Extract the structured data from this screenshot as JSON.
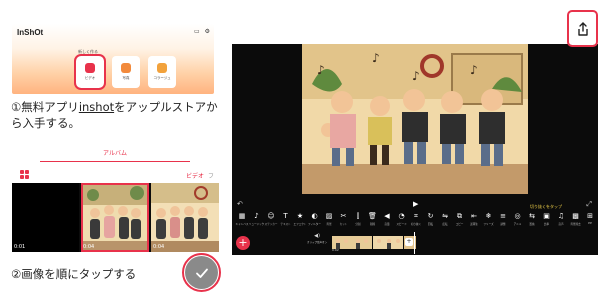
{
  "step1": {
    "app_logo": "InShOt",
    "prompt": "新しく作る",
    "cards": [
      {
        "label": "ビデオ",
        "icon": "video-icon",
        "color": "#e8324b"
      },
      {
        "label": "写真",
        "icon": "photo-icon",
        "color": "#f28a3c"
      },
      {
        "label": "コラージュ",
        "icon": "collage-icon",
        "color": "#f2a23c"
      }
    ],
    "caption_a": "①無料アプリ",
    "caption_link": "inshot",
    "caption_b": "をアップルストアから入手する。"
  },
  "step2": {
    "album_tab": "アルバム",
    "video_tab": "ビデオ",
    "more_tab": "フ",
    "thumbs": [
      {
        "duration": "0:01"
      },
      {
        "duration": "0:04"
      },
      {
        "duration": "0:04"
      }
    ],
    "caption": "②画像を順にタップする",
    "confirm_icon": "check-icon"
  },
  "editor": {
    "tip": "切り抜くをタップ",
    "tools": [
      {
        "label": "キャンバス",
        "glyph": "▦"
      },
      {
        "label": "ミュージック",
        "glyph": "♪"
      },
      {
        "label": "ステッカー",
        "glyph": "☺"
      },
      {
        "label": "テキスト",
        "glyph": "T"
      },
      {
        "label": "エフェクト",
        "glyph": "★"
      },
      {
        "label": "フィルター",
        "glyph": "◐"
      },
      {
        "label": "背景",
        "glyph": "▨"
      },
      {
        "label": "カット",
        "glyph": "✂"
      },
      {
        "label": "分割",
        "glyph": "⫿"
      },
      {
        "label": "削除",
        "glyph": "🗑"
      },
      {
        "label": "音量",
        "glyph": "◀"
      },
      {
        "label": "スピード",
        "glyph": "◔"
      },
      {
        "label": "切り抜く",
        "glyph": "⌗"
      },
      {
        "label": "回転",
        "glyph": "↻"
      },
      {
        "label": "反転",
        "glyph": "⇋"
      },
      {
        "label": "コピー",
        "glyph": "⧉"
      },
      {
        "label": "逆再生",
        "glyph": "⇤"
      },
      {
        "label": "フリーズ",
        "glyph": "❄"
      },
      {
        "label": "調整",
        "glyph": "≡"
      },
      {
        "label": "アニメ",
        "glyph": "◎"
      },
      {
        "label": "置換",
        "glyph": "⇆"
      },
      {
        "label": "比率",
        "glyph": "▣"
      },
      {
        "label": "音声",
        "glyph": "♫"
      },
      {
        "label": "背景除去",
        "glyph": "▩"
      },
      {
        "label": "PIP",
        "glyph": "⊞"
      }
    ],
    "mute_label": "クリップ音声オン",
    "clip_time": "0:02",
    "share_icon": "share-icon"
  },
  "colors": {
    "accent": "#e8324b",
    "editor_bg": "#0b0b0b"
  }
}
